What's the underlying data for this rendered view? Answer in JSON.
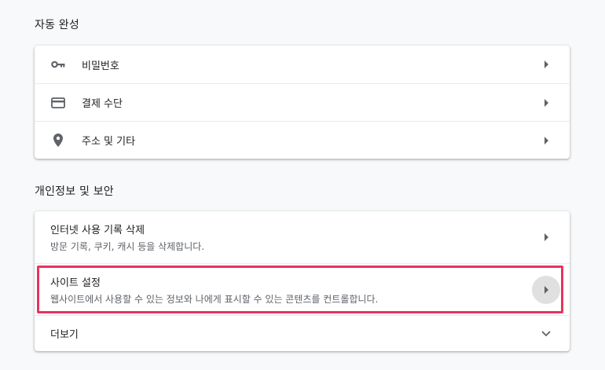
{
  "autofill": {
    "title": "자동 완성",
    "items": [
      {
        "label": "비밀번호",
        "icon": "key-icon"
      },
      {
        "label": "결제 수단",
        "icon": "credit-card-icon"
      },
      {
        "label": "주소 및 기타",
        "icon": "location-pin-icon"
      }
    ]
  },
  "privacy": {
    "title": "개인정보 및 보안",
    "items": [
      {
        "label": "인터넷 사용 기록 삭제",
        "sub": "방문 기록, 쿠키, 캐시 등을 삭제합니다."
      },
      {
        "label": "사이트 설정",
        "sub": "웹사이트에서 사용할 수 있는 정보와 나에게 표시할 수 있는 콘텐츠를 컨트롤합니다."
      }
    ],
    "more_label": "더보기"
  },
  "colors": {
    "highlight": "#e8335f",
    "background": "#f8f9fa",
    "icon": "#5f6368"
  }
}
